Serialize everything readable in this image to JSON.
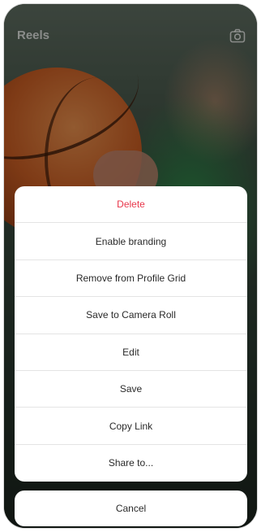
{
  "header": {
    "title": "Reels",
    "camera_icon": "camera-icon"
  },
  "action_sheet": {
    "items": [
      {
        "label": "Delete",
        "style": "destructive",
        "color": "#e8364a"
      },
      {
        "label": "Enable branding"
      },
      {
        "label": "Remove from Profile Grid"
      },
      {
        "label": "Save to Camera Roll"
      },
      {
        "label": "Edit"
      },
      {
        "label": "Save"
      },
      {
        "label": "Copy Link"
      },
      {
        "label": "Share to..."
      }
    ],
    "cancel_label": "Cancel"
  }
}
